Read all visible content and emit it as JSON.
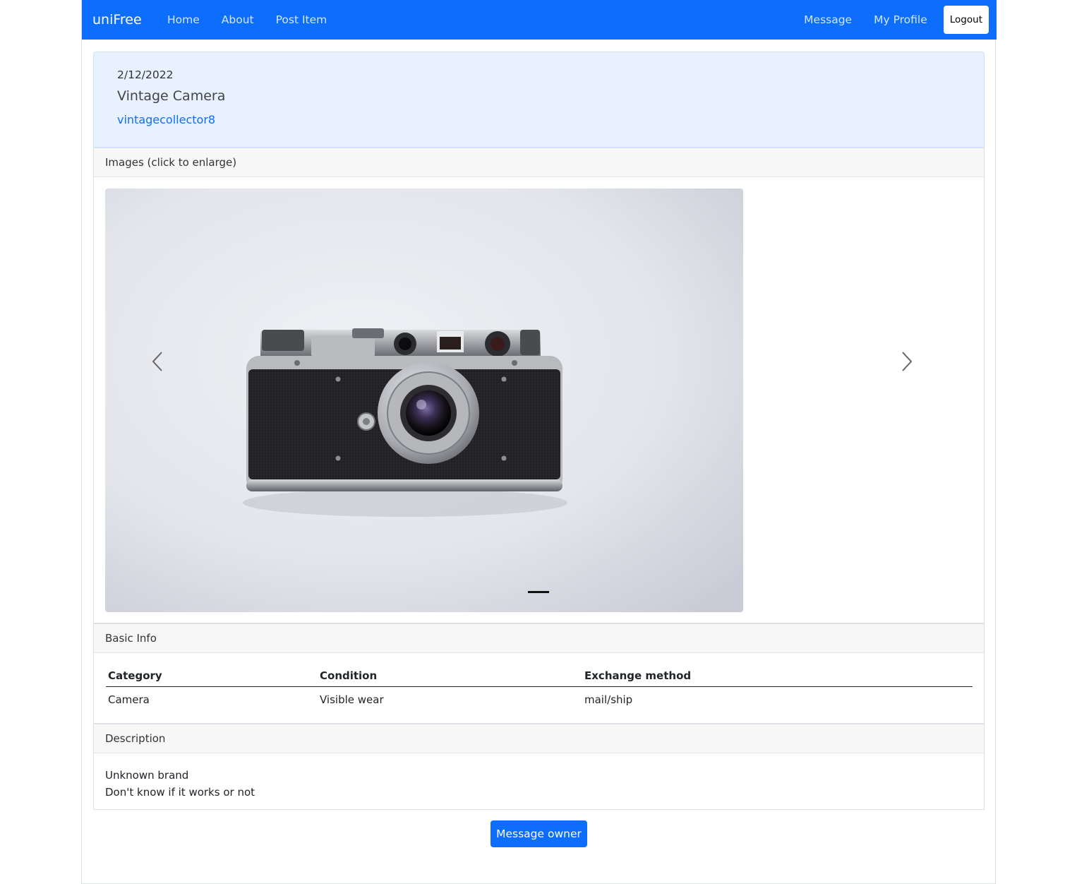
{
  "navbar": {
    "brand": "uniFree",
    "left_links": [
      "Home",
      "About",
      "Post Item"
    ],
    "right_links": [
      "Message",
      "My Profile"
    ],
    "logout_label": "Logout"
  },
  "post": {
    "date": "2/12/2022",
    "title": "Vintage Camera",
    "owner": "vintagecollector8"
  },
  "images_section": {
    "header": "Images (click to enlarge)",
    "active_slide_index": 0,
    "slide_count": 1,
    "slide_subject": "vintage rangefinder camera photo"
  },
  "basic_info": {
    "header": "Basic Info",
    "columns": [
      "Category",
      "Condition",
      "Exchange method"
    ],
    "rows": [
      [
        "Camera",
        "Visible wear",
        "mail/ship"
      ]
    ]
  },
  "description": {
    "header": "Description",
    "lines": [
      "Unknown brand",
      "Don't know if it works or not"
    ]
  },
  "actions": {
    "message_owner_label": "Message owner"
  },
  "colors": {
    "primary": "#0d6efd",
    "header_card_bg": "#e7f1ff"
  }
}
